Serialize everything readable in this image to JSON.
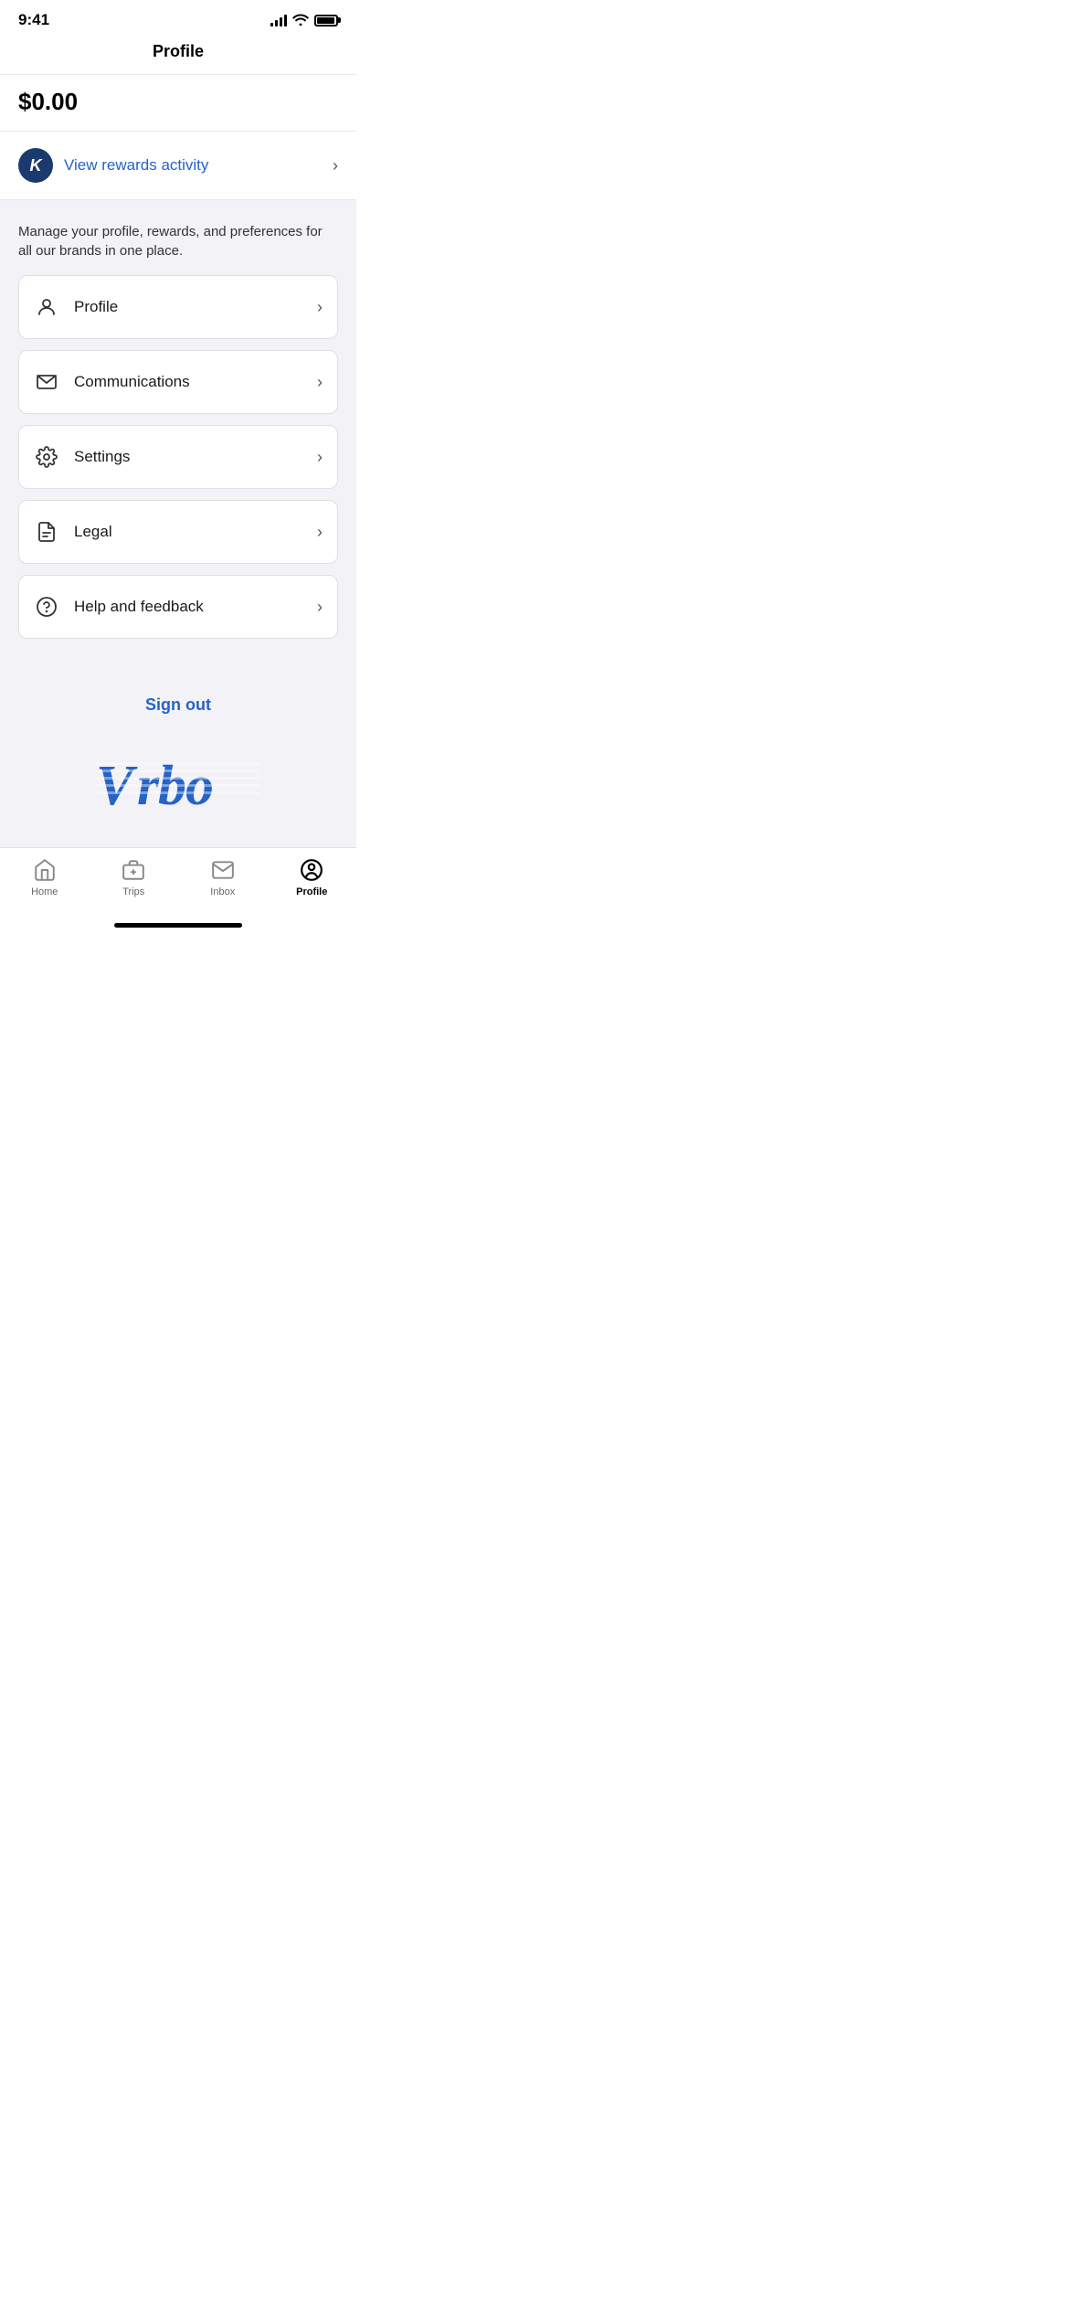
{
  "statusBar": {
    "time": "9:41"
  },
  "header": {
    "title": "Profile"
  },
  "balance": {
    "amount": "$0.00"
  },
  "rewards": {
    "iconLetter": "K",
    "linkText": "View rewards activity",
    "arrowLabel": "›"
  },
  "manageSection": {
    "description": "Manage your profile, rewards, and preferences for all our brands in one place."
  },
  "menuItems": [
    {
      "id": "profile",
      "label": "Profile",
      "icon": "person"
    },
    {
      "id": "communications",
      "label": "Communications",
      "icon": "mail"
    },
    {
      "id": "settings",
      "label": "Settings",
      "icon": "gear"
    },
    {
      "id": "legal",
      "label": "Legal",
      "icon": "document"
    },
    {
      "id": "help",
      "label": "Help and feedback",
      "icon": "question"
    }
  ],
  "signout": {
    "label": "Sign out"
  },
  "bottomNav": {
    "items": [
      {
        "id": "home",
        "label": "Home",
        "active": false
      },
      {
        "id": "trips",
        "label": "Trips",
        "active": false
      },
      {
        "id": "inbox",
        "label": "Inbox",
        "active": false
      },
      {
        "id": "profile",
        "label": "Profile",
        "active": true
      }
    ]
  }
}
